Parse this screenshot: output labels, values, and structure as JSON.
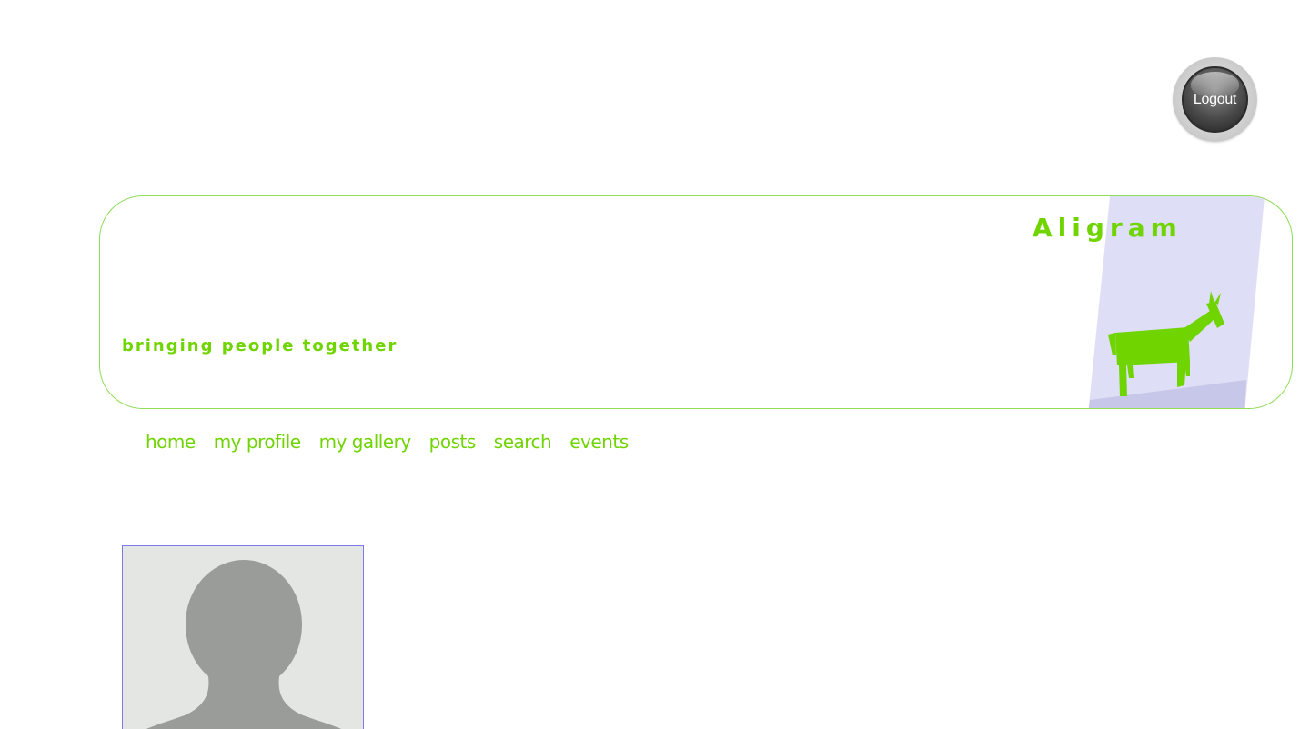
{
  "header": {
    "logout_label": "Logout"
  },
  "banner": {
    "site_title": "Aligram",
    "tagline": "bringing people together"
  },
  "nav": {
    "items": [
      {
        "label": "home"
      },
      {
        "label": "my profile"
      },
      {
        "label": "my gallery"
      },
      {
        "label": "posts"
      },
      {
        "label": "search"
      },
      {
        "label": "events"
      }
    ]
  },
  "profile": {
    "avatar_icon": "default-user-silhouette-icon"
  },
  "colors": {
    "accent_green": "#6fd400",
    "banner_border": "#8fdc55",
    "banner_panel": "#dedef6",
    "avatar_border": "#7b7bef",
    "avatar_bg": "#e4e6e4",
    "silhouette": "#9a9c9a"
  }
}
